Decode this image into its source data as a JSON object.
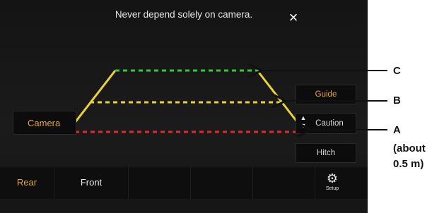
{
  "warning": {
    "text": "Never depend solely on camera."
  },
  "close_icon": "×",
  "buttons": {
    "camera": "Camera",
    "guide": "Guide",
    "caution": "Caution",
    "hitch": "Hitch"
  },
  "bottom": {
    "rear": "Rear",
    "front": "Front",
    "setup": "Setup"
  },
  "callouts": {
    "c": "C",
    "b": "B",
    "a": "A",
    "a_note": "(about\n0.5 m)"
  },
  "colors": {
    "guide_green": "#35c93a",
    "guide_yellow": "#e8d23a",
    "guide_red": "#e02a2a",
    "accent_orange": "#e0a640"
  }
}
